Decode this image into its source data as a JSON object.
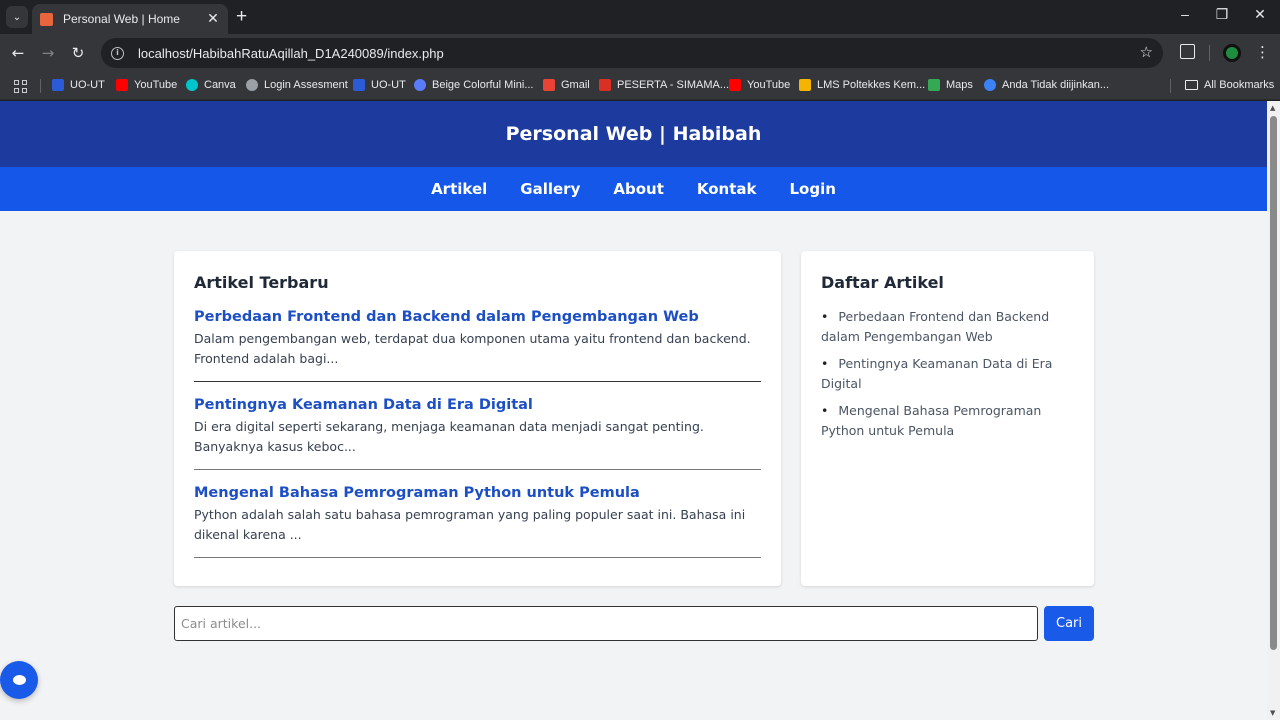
{
  "browser": {
    "tab": {
      "title": "Personal Web | Home"
    },
    "url": "localhost/HabibahRatuAqillah_D1A240089/index.php",
    "bookmarks": [
      {
        "label": "UO-UT",
        "icon": "ut-icon",
        "color": "#2b5bd7"
      },
      {
        "label": "YouTube",
        "icon": "youtube-icon",
        "color": "#ff0000"
      },
      {
        "label": "Canva",
        "icon": "canva-icon",
        "color": "#00c4cc"
      },
      {
        "label": "Login Assesment",
        "icon": "globe-icon",
        "color": "#9aa0a6"
      },
      {
        "label": "UO-UT",
        "icon": "ut-icon",
        "color": "#2b5bd7"
      },
      {
        "label": "Beige Colorful Mini...",
        "icon": "canva-icon",
        "color": "#5b7cfa"
      },
      {
        "label": "Gmail",
        "icon": "gmail-icon",
        "color": "#ea4335"
      },
      {
        "label": "PESERTA - SIMAMA...",
        "icon": "simama-icon",
        "color": "#d93025"
      },
      {
        "label": "YouTube",
        "icon": "youtube-icon",
        "color": "#ff0000"
      },
      {
        "label": "LMS Poltekkes Kem...",
        "icon": "lms-icon",
        "color": "#f4b400"
      },
      {
        "label": "Maps",
        "icon": "maps-icon",
        "color": "#34a853"
      },
      {
        "label": "Anda Tidak diijinkan...",
        "icon": "kemdikbud-icon",
        "color": "#3b82f6"
      }
    ],
    "all_bookmarks": "All Bookmarks"
  },
  "site": {
    "title": "Personal Web | Habibah",
    "nav": [
      "Artikel",
      "Gallery",
      "About",
      "Kontak",
      "Login"
    ],
    "colors": {
      "header": "#1d3a9e",
      "nav": "#1557e8",
      "link": "#1d4fc4",
      "button": "#1a5ae8"
    }
  },
  "main": {
    "heading": "Artikel Terbaru",
    "articles": [
      {
        "title": "Perbedaan Frontend dan Backend dalam Pengembangan Web",
        "excerpt": "Dalam pengembangan web, terdapat dua komponen utama yaitu frontend dan backend. Frontend adalah bagi..."
      },
      {
        "title": "Pentingnya Keamanan Data di Era Digital",
        "excerpt": "Di era digital seperti sekarang, menjaga keamanan data menjadi sangat penting. Banyaknya kasus keboc..."
      },
      {
        "title": "Mengenal Bahasa Pemrograman Python untuk Pemula",
        "excerpt": "Python adalah salah satu bahasa pemrograman yang paling populer saat ini. Bahasa ini dikenal karena ..."
      }
    ]
  },
  "sidebar": {
    "heading": "Daftar Artikel",
    "items": [
      "Perbedaan Frontend dan Backend dalam Pengembangan Web",
      "Pentingnya Keamanan Data di Era Digital",
      "Mengenal Bahasa Pemrograman Python untuk Pemula"
    ]
  },
  "search": {
    "placeholder": "Cari artikel...",
    "value": "",
    "button": "Cari"
  }
}
